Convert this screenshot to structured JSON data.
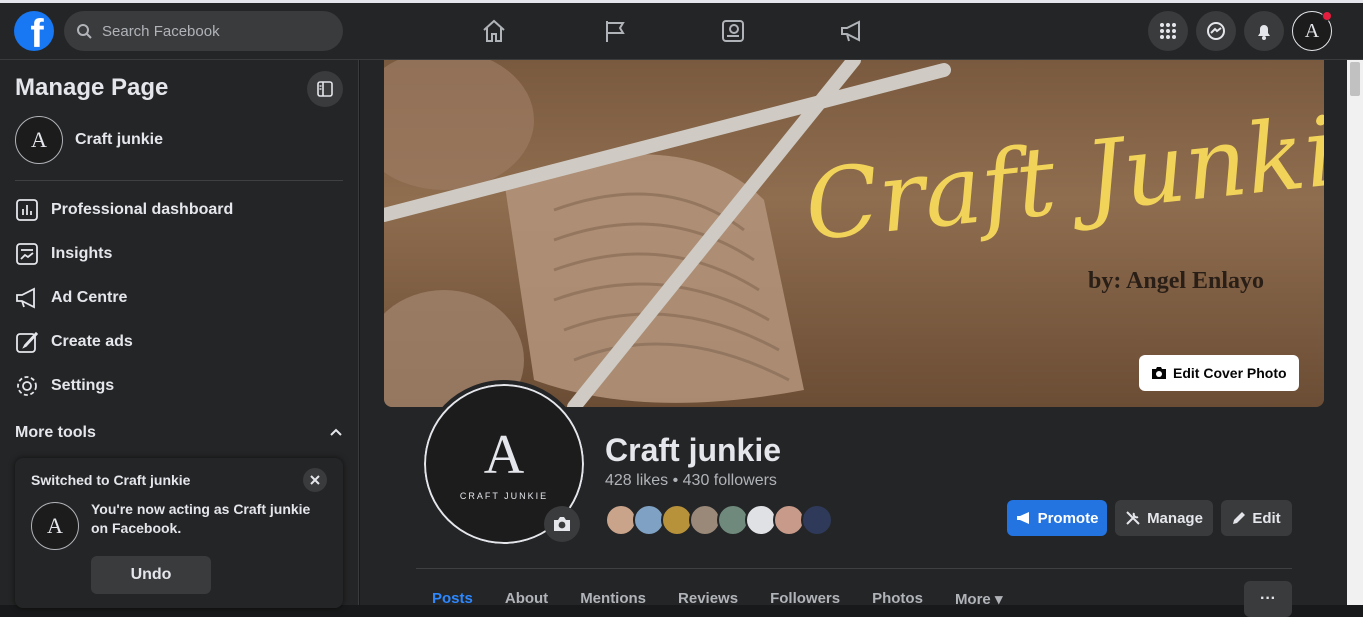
{
  "topbar": {
    "search_placeholder": "Search Facebook",
    "logo_letter": "f",
    "nav_icons": [
      "home-icon",
      "flag-icon",
      "news-icon",
      "megaphone-icon"
    ],
    "right_icons": [
      "menu-grid-icon",
      "messenger-icon",
      "bell-icon"
    ],
    "avatar_letter": "A"
  },
  "sidebar": {
    "title": "Manage Page",
    "page_name": "Craft junkie",
    "avatar_letter": "A",
    "items": [
      {
        "label": "Professional dashboard",
        "icon": "dashboard-icon"
      },
      {
        "label": "Insights",
        "icon": "insights-icon"
      },
      {
        "label": "Ad Centre",
        "icon": "megaphone-icon"
      },
      {
        "label": "Create ads",
        "icon": "edit-icon"
      },
      {
        "label": "Settings",
        "icon": "gear-icon"
      }
    ],
    "more_tools": "More tools"
  },
  "toast": {
    "title": "Switched to Craft junkie",
    "message": "You're now acting as Craft junkie on Facebook.",
    "undo": "Undo"
  },
  "cover": {
    "title": "Craft Junkie",
    "subtitle": "by: Angel Enlayo",
    "edit_button": "Edit Cover Photo"
  },
  "profile": {
    "monogram": "A",
    "logo_text": "CRAFT JUNKIE",
    "name": "Craft junkie",
    "stats": "428 likes • 430 followers",
    "buttons": {
      "promote": "Promote",
      "manage": "Manage",
      "edit": "Edit"
    },
    "avatar_colors": [
      "#c9a38a",
      "#7fa2c4",
      "#b8923a",
      "#9a8878",
      "#6f8a7c",
      "#dfe1e4",
      "#c89a8a",
      "#2f3a5a"
    ]
  },
  "tabs": [
    {
      "label": "Posts",
      "active": true
    },
    {
      "label": "About"
    },
    {
      "label": "Mentions"
    },
    {
      "label": "Reviews"
    },
    {
      "label": "Followers"
    },
    {
      "label": "Photos"
    },
    {
      "label": "More ▾"
    }
  ],
  "more_dots": "···",
  "colors": {
    "accent": "#2374e1",
    "active_tab": "#2d88ff",
    "cover_text": "#f2d35a",
    "background": "#18191a",
    "surface": "#242526"
  }
}
